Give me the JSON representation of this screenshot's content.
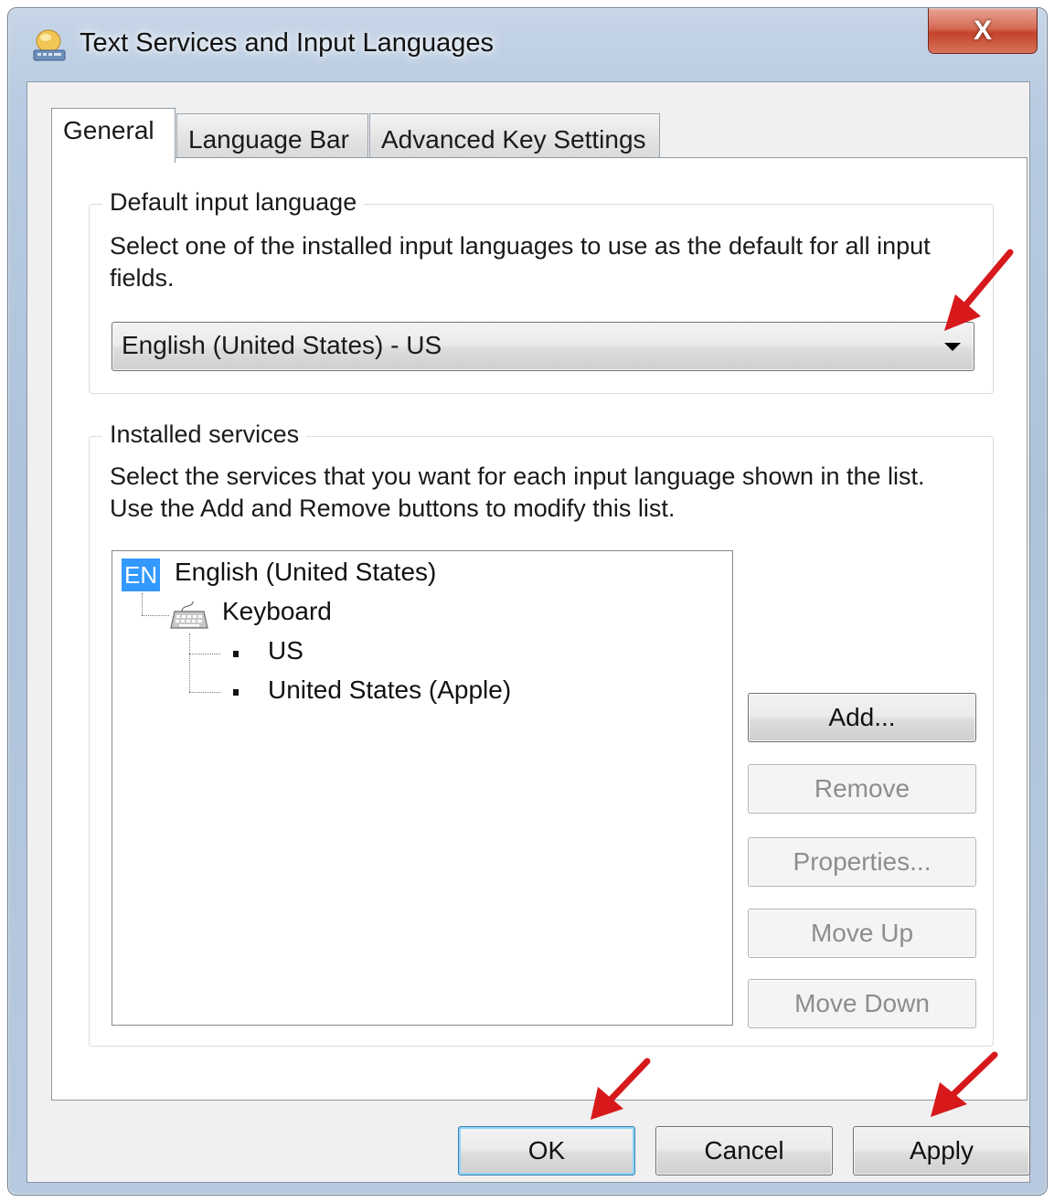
{
  "window": {
    "title": "Text Services and Input Languages",
    "close_label": "X"
  },
  "tabs": [
    {
      "label": "General",
      "active": true
    },
    {
      "label": "Language Bar",
      "active": false
    },
    {
      "label": "Advanced Key Settings",
      "active": false
    }
  ],
  "default_language": {
    "group_label": "Default input language",
    "description_line1": "Select one of the installed input languages to use as the default for all input",
    "description_line2": "fields.",
    "selected_value": "English (United States) - US"
  },
  "installed_services": {
    "group_label": "Installed services",
    "description_line1": "Select the services that you want for each input language shown in the list.",
    "description_line2": "Use the Add and Remove buttons to modify this list.",
    "tree": {
      "language_badge": "EN",
      "language_name": "English (United States)",
      "category": "Keyboard",
      "layouts": [
        "US",
        "United States (Apple)"
      ]
    },
    "buttons": {
      "add": "Add...",
      "remove": "Remove",
      "properties": "Properties...",
      "move_up": "Move Up",
      "move_down": "Move Down"
    }
  },
  "footer": {
    "ok": "OK",
    "cancel": "Cancel",
    "apply": "Apply"
  },
  "colors": {
    "annotation_arrow": "#d7191c",
    "selection_highlight": "#3399ff",
    "default_button_glow": "#8ed3f8"
  },
  "icons": [
    "language-bar-icon",
    "close-icon",
    "dropdown-arrow-icon",
    "keyboard-icon",
    "annotation-arrow-icon"
  ]
}
